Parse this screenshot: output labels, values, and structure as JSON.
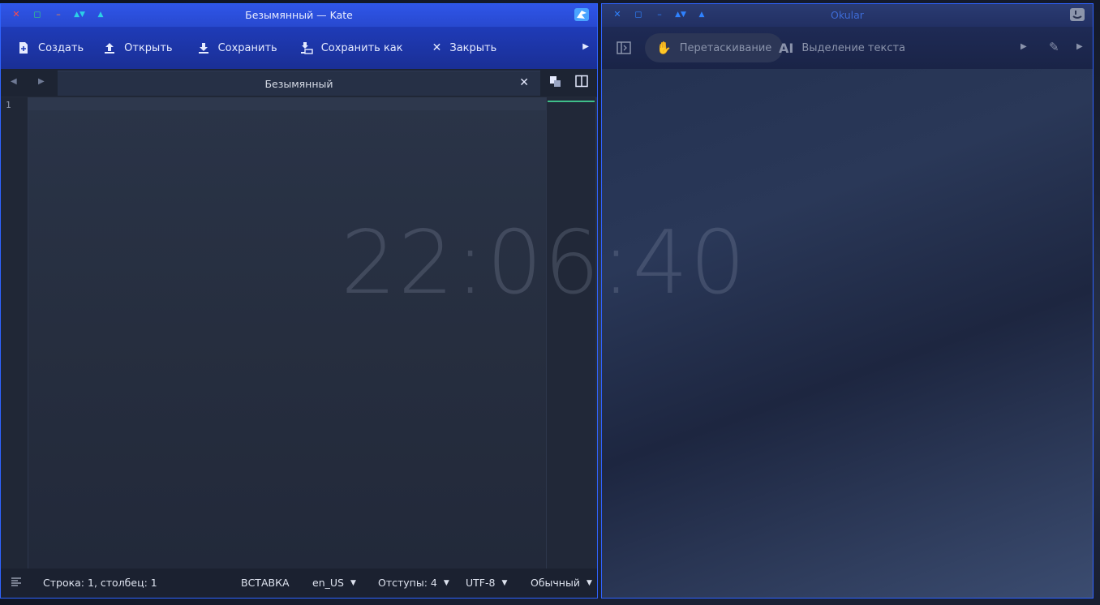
{
  "desktop": {
    "clock": "22:06:40"
  },
  "kate": {
    "title": "Безымянный — Kate",
    "icons": [
      "close-icon",
      "maximize-icon",
      "minimize-icon",
      "keep-below-icon",
      "keep-above-icon",
      "kate-logo-icon"
    ],
    "toolbar": {
      "new": "Создать",
      "open": "Открыть",
      "save": "Сохранить",
      "save_as": "Сохранить как",
      "close": "Закрыть"
    },
    "tab": {
      "name": "Безымянный"
    },
    "editor": {
      "line_number": "1"
    },
    "status": {
      "position": "Строка: 1, столбец: 1",
      "mode": "ВСТАВКА",
      "language": "en_US",
      "indent": "Отступы: 4",
      "encoding": "UTF-8",
      "highlight": "Обычный"
    },
    "colors": {
      "accent": "#2f55e8",
      "minimap_marker": "#3fbf8a"
    }
  },
  "okular": {
    "title": "Okular",
    "toolbar": {
      "drag": "Перетаскивание",
      "text_select": "Выделение текста"
    }
  }
}
